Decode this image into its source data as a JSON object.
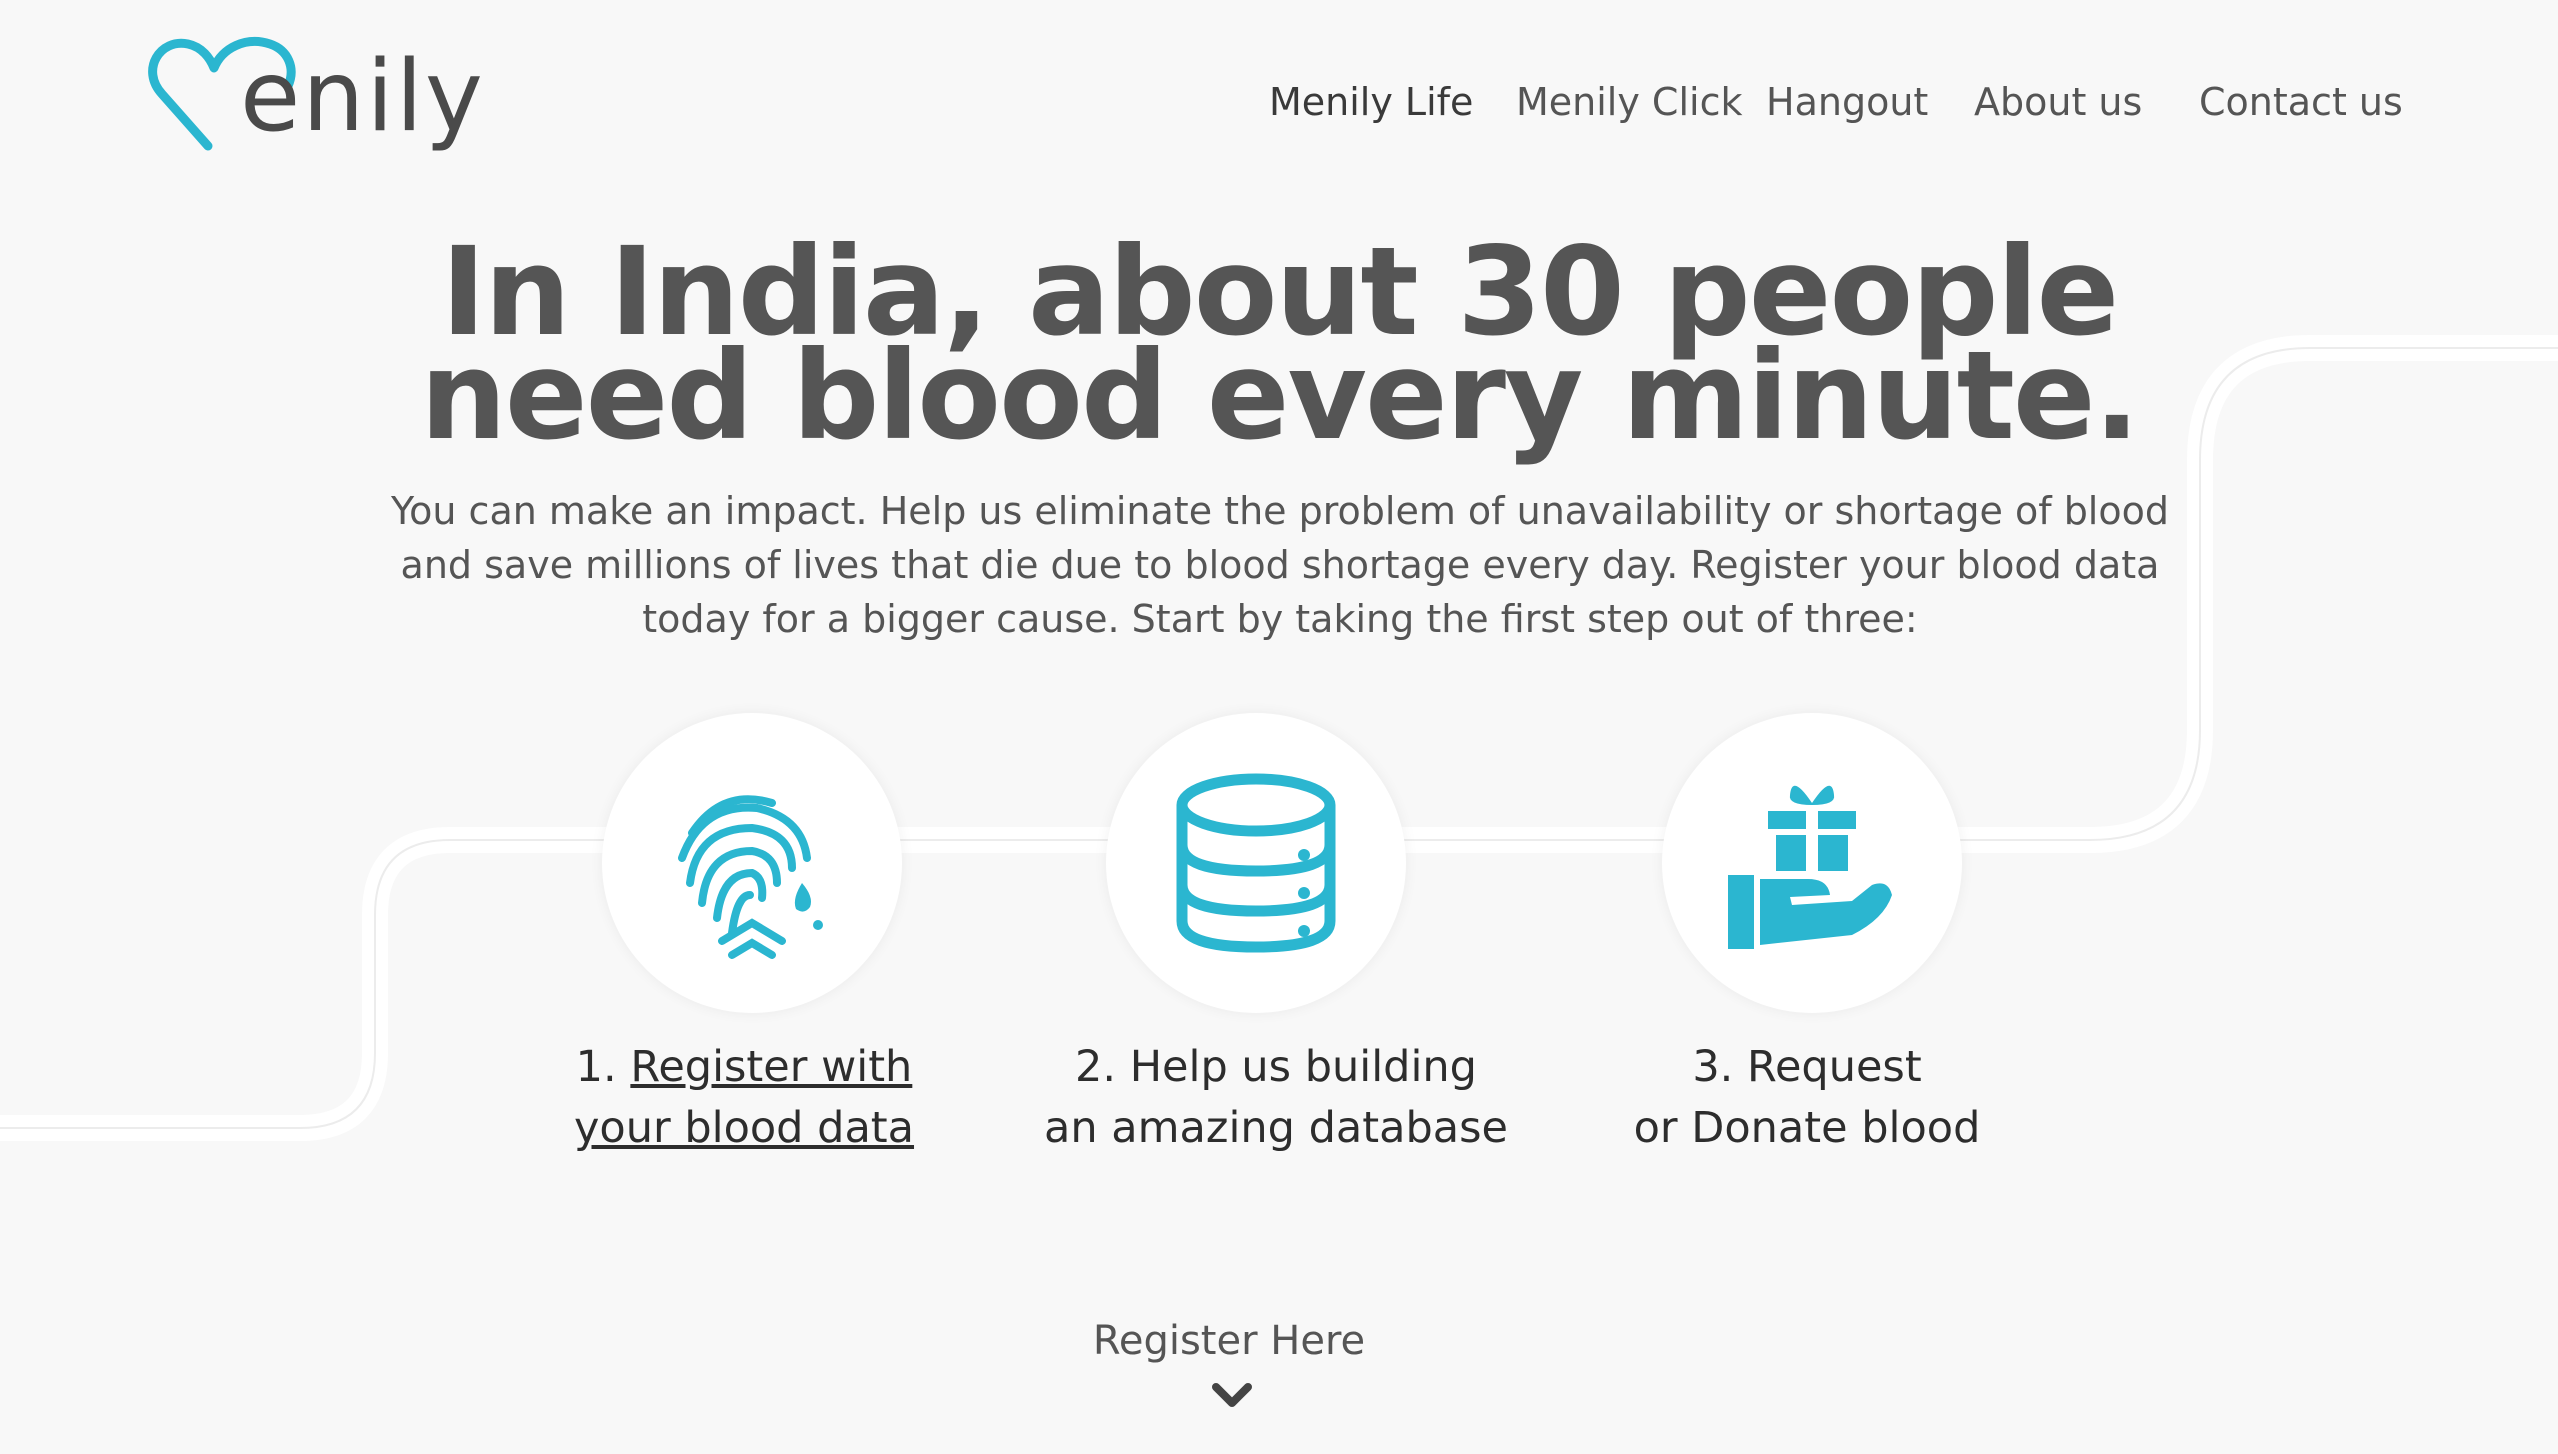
{
  "brand": {
    "logo_text": "enily",
    "accent_color": "#2bb6d0",
    "logo_icon": "heart-outline-icon"
  },
  "nav": {
    "items": [
      {
        "label": "Menily Life",
        "active": true
      },
      {
        "label": "Menily Click",
        "active": false
      },
      {
        "label": "Hangout",
        "active": false
      },
      {
        "label": "About us",
        "active": false
      },
      {
        "label": "Contact us",
        "active": false
      }
    ]
  },
  "hero": {
    "headline_line1": "In India, about 30 people",
    "headline_line2": "need blood every minute.",
    "subtext": "You can make an impact. Help us eliminate the problem of unavailability or shortage of blood and save millions of lives that die due to blood shortage every day. Register your blood data today for a bigger cause. Start by taking the first step out of three:"
  },
  "steps": [
    {
      "number": "1.",
      "line1": "Register with",
      "line2": "your blood data",
      "icon": "fingerprint-blood-icon"
    },
    {
      "number": "2.",
      "line1": "Help us building",
      "line2": "an amazing database",
      "icon": "database-icon"
    },
    {
      "number": "3.",
      "line1": "Request",
      "line2": "or Donate blood",
      "icon": "gift-hand-icon"
    }
  ],
  "cta": {
    "label": "Register Here",
    "icon": "chevron-down-icon"
  }
}
